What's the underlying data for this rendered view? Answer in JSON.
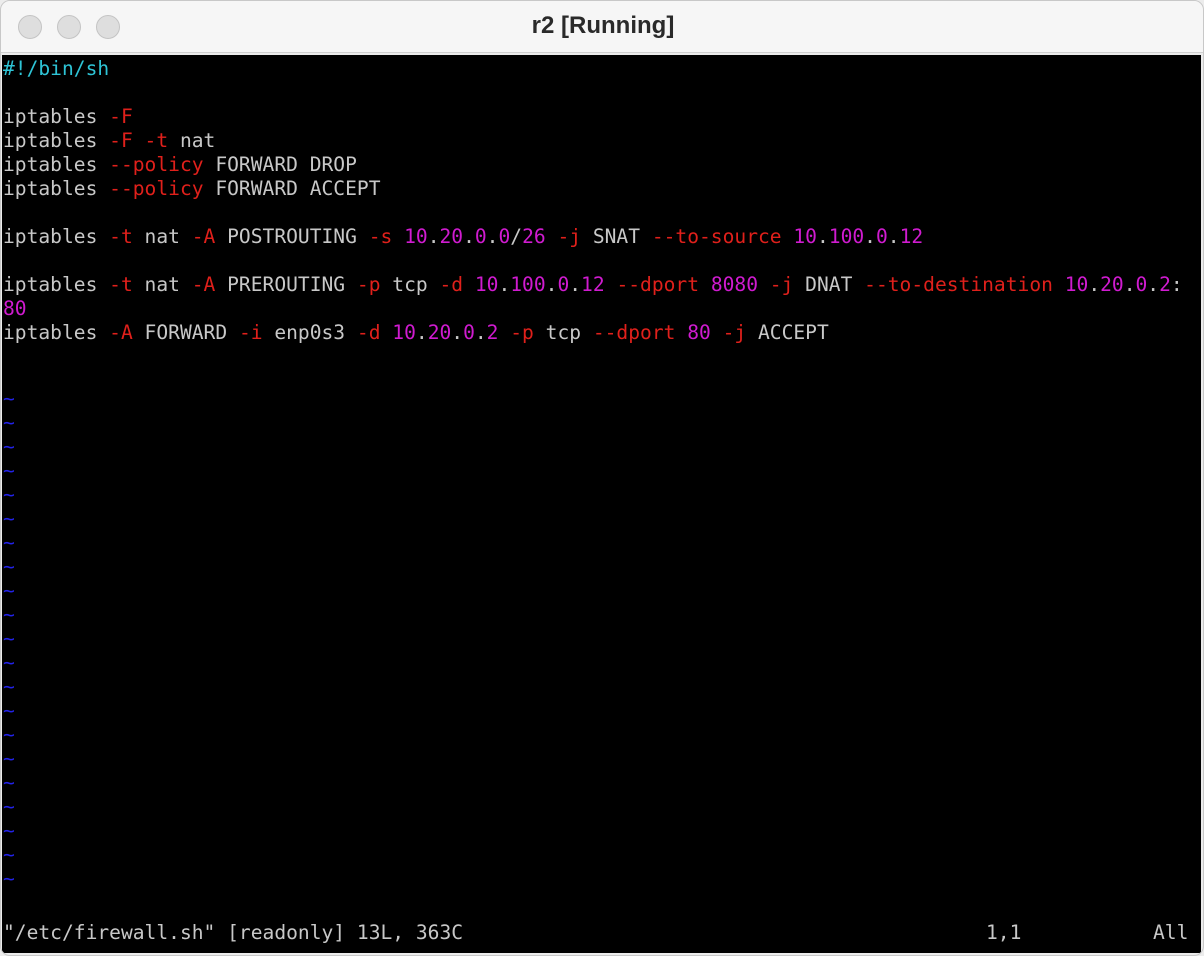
{
  "window": {
    "title": "r2 [Running]"
  },
  "editor": {
    "shebang": "#!/bin/sh",
    "lines": [
      {
        "parts": [
          {
            "t": "iptables ",
            "c": "wh"
          },
          {
            "t": "-F",
            "c": "rd"
          }
        ]
      },
      {
        "parts": [
          {
            "t": "iptables ",
            "c": "wh"
          },
          {
            "t": "-F -t",
            "c": "rd"
          },
          {
            "t": " nat",
            "c": "wh"
          }
        ]
      },
      {
        "parts": [
          {
            "t": "iptables ",
            "c": "wh"
          },
          {
            "t": "--policy",
            "c": "rd"
          },
          {
            "t": " FORWARD DROP",
            "c": "wh"
          }
        ]
      },
      {
        "parts": [
          {
            "t": "iptables ",
            "c": "wh"
          },
          {
            "t": "--policy",
            "c": "rd"
          },
          {
            "t": " FORWARD ACCEPT",
            "c": "wh"
          }
        ]
      },
      {
        "parts": [
          {
            "t": "iptables ",
            "c": "wh"
          },
          {
            "t": "-t",
            "c": "rd"
          },
          {
            "t": " nat ",
            "c": "wh"
          },
          {
            "t": "-A",
            "c": "rd"
          },
          {
            "t": " POSTROUTING ",
            "c": "wh"
          },
          {
            "t": "-s",
            "c": "rd"
          },
          {
            "t": " ",
            "c": "wh"
          },
          {
            "t": "10",
            "c": "mg"
          },
          {
            "t": ".",
            "c": "wh"
          },
          {
            "t": "20",
            "c": "mg"
          },
          {
            "t": ".",
            "c": "wh"
          },
          {
            "t": "0",
            "c": "mg"
          },
          {
            "t": ".",
            "c": "wh"
          },
          {
            "t": "0",
            "c": "mg"
          },
          {
            "t": "/",
            "c": "wh"
          },
          {
            "t": "26",
            "c": "mg"
          },
          {
            "t": " ",
            "c": "wh"
          },
          {
            "t": "-j",
            "c": "rd"
          },
          {
            "t": " SNAT ",
            "c": "wh"
          },
          {
            "t": "--to-source",
            "c": "rd"
          },
          {
            "t": " ",
            "c": "wh"
          },
          {
            "t": "10",
            "c": "mg"
          },
          {
            "t": ".",
            "c": "wh"
          },
          {
            "t": "100",
            "c": "mg"
          },
          {
            "t": ".",
            "c": "wh"
          },
          {
            "t": "0",
            "c": "mg"
          },
          {
            "t": ".",
            "c": "wh"
          },
          {
            "t": "12",
            "c": "mg"
          }
        ]
      },
      {
        "parts": [
          {
            "t": "iptables ",
            "c": "wh"
          },
          {
            "t": "-t",
            "c": "rd"
          },
          {
            "t": " nat ",
            "c": "wh"
          },
          {
            "t": "-A",
            "c": "rd"
          },
          {
            "t": " PREROUTING ",
            "c": "wh"
          },
          {
            "t": "-p",
            "c": "rd"
          },
          {
            "t": " tcp ",
            "c": "wh"
          },
          {
            "t": "-d",
            "c": "rd"
          },
          {
            "t": " ",
            "c": "wh"
          },
          {
            "t": "10",
            "c": "mg"
          },
          {
            "t": ".",
            "c": "wh"
          },
          {
            "t": "100",
            "c": "mg"
          },
          {
            "t": ".",
            "c": "wh"
          },
          {
            "t": "0",
            "c": "mg"
          },
          {
            "t": ".",
            "c": "wh"
          },
          {
            "t": "12",
            "c": "mg"
          },
          {
            "t": " ",
            "c": "wh"
          },
          {
            "t": "--dport",
            "c": "rd"
          },
          {
            "t": " ",
            "c": "wh"
          },
          {
            "t": "8080",
            "c": "mg"
          },
          {
            "t": " ",
            "c": "wh"
          },
          {
            "t": "-j",
            "c": "rd"
          },
          {
            "t": " DNAT ",
            "c": "wh"
          },
          {
            "t": "--to-destination",
            "c": "rd"
          },
          {
            "t": " ",
            "c": "wh"
          },
          {
            "t": "10",
            "c": "mg"
          },
          {
            "t": ".",
            "c": "wh"
          },
          {
            "t": "20",
            "c": "mg"
          },
          {
            "t": ".",
            "c": "wh"
          },
          {
            "t": "0",
            "c": "mg"
          },
          {
            "t": ".",
            "c": "wh"
          },
          {
            "t": "2",
            "c": "mg"
          },
          {
            "t": ":",
            "c": "wh"
          }
        ]
      },
      {
        "parts": [
          {
            "t": "80",
            "c": "mg"
          }
        ]
      },
      {
        "parts": [
          {
            "t": "iptables ",
            "c": "wh"
          },
          {
            "t": "-A",
            "c": "rd"
          },
          {
            "t": " FORWARD ",
            "c": "wh"
          },
          {
            "t": "-i",
            "c": "rd"
          },
          {
            "t": " enp0s3 ",
            "c": "wh"
          },
          {
            "t": "-d",
            "c": "rd"
          },
          {
            "t": " ",
            "c": "wh"
          },
          {
            "t": "10",
            "c": "mg"
          },
          {
            "t": ".",
            "c": "wh"
          },
          {
            "t": "20",
            "c": "mg"
          },
          {
            "t": ".",
            "c": "wh"
          },
          {
            "t": "0",
            "c": "mg"
          },
          {
            "t": ".",
            "c": "wh"
          },
          {
            "t": "2",
            "c": "mg"
          },
          {
            "t": " ",
            "c": "wh"
          },
          {
            "t": "-p",
            "c": "rd"
          },
          {
            "t": " tcp ",
            "c": "wh"
          },
          {
            "t": "--dport",
            "c": "rd"
          },
          {
            "t": " ",
            "c": "wh"
          },
          {
            "t": "80",
            "c": "mg"
          },
          {
            "t": " ",
            "c": "wh"
          },
          {
            "t": "-j",
            "c": "rd"
          },
          {
            "t": " ACCEPT",
            "c": "wh"
          }
        ]
      }
    ],
    "tilde": "~"
  },
  "status": {
    "file_info": "\"/etc/firewall.sh\" [readonly] 13L, 363C",
    "cursor": "1,1",
    "scroll": "All"
  },
  "colors": {
    "comment": "#2ec4d6",
    "option": "#e0201b",
    "number": "#d01bd0",
    "text": "#c8c8c8",
    "tilde": "#2222e8",
    "background": "#000000"
  }
}
